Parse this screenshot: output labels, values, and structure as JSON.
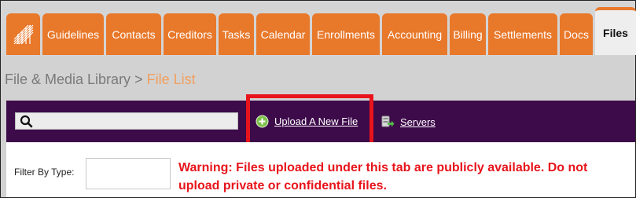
{
  "nav": {
    "tabs": [
      {
        "label": "Guidelines"
      },
      {
        "label": "Contacts"
      },
      {
        "label": "Creditors"
      },
      {
        "label": "Tasks"
      },
      {
        "label": "Calendar"
      },
      {
        "label": "Enrollments"
      },
      {
        "label": "Accounting"
      },
      {
        "label": "Billing"
      },
      {
        "label": "Settlements"
      },
      {
        "label": "Docs"
      },
      {
        "label": "Files",
        "active": true
      }
    ],
    "logo_icon": "striped-logo-icon"
  },
  "breadcrumb": {
    "parent": "File & Media Library",
    "separator": " > ",
    "current": "File List"
  },
  "toolbar": {
    "search_placeholder": "",
    "search_icon": "search-icon",
    "upload_label": "Upload A New File",
    "upload_icon": "plus-circle-icon",
    "servers_label": "Servers",
    "servers_icon": "servers-icon"
  },
  "filter": {
    "label": "Filter By Type:",
    "value": ""
  },
  "warning": {
    "text": "Warning: Files uploaded under this tab are publicly available. Do not upload private or confidential files."
  },
  "colors": {
    "tab_orange": "#e8782a",
    "toolbar_purple": "#3d0a4a",
    "breadcrumb_current": "#f0a060",
    "warning_red": "#e8141b"
  }
}
